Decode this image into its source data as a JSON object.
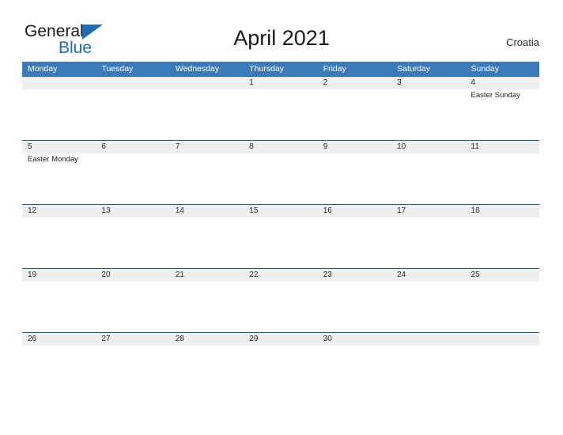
{
  "brand": {
    "name_part1": "General",
    "name_part2": "Blue",
    "triangle_icon": "triangle-right-icon",
    "color_dark": "#1a1a1a",
    "color_blue": "#1f6ab0"
  },
  "header": {
    "title": "April 2021",
    "region": "Croatia"
  },
  "theme": {
    "header_blue": "#3a7ab8",
    "rule_blue": "#1f5c9e",
    "date_band_gray": "#efefef",
    "page_background": "#ffffff",
    "text_color": "#2b2b2b"
  },
  "calendar": {
    "month": "April",
    "year": "2021",
    "weekday_headers": [
      "Monday",
      "Tuesday",
      "Wednesday",
      "Thursday",
      "Friday",
      "Saturday",
      "Sunday"
    ],
    "weeks": [
      {
        "days": [
          {
            "date": "",
            "events": []
          },
          {
            "date": "",
            "events": []
          },
          {
            "date": "",
            "events": []
          },
          {
            "date": "1",
            "events": []
          },
          {
            "date": "2",
            "events": []
          },
          {
            "date": "3",
            "events": []
          },
          {
            "date": "4",
            "events": [
              "Easter Sunday"
            ]
          }
        ]
      },
      {
        "days": [
          {
            "date": "5",
            "events": [
              "Easter Monday"
            ]
          },
          {
            "date": "6",
            "events": []
          },
          {
            "date": "7",
            "events": []
          },
          {
            "date": "8",
            "events": []
          },
          {
            "date": "9",
            "events": []
          },
          {
            "date": "10",
            "events": []
          },
          {
            "date": "11",
            "events": []
          }
        ]
      },
      {
        "days": [
          {
            "date": "12",
            "events": []
          },
          {
            "date": "13",
            "events": []
          },
          {
            "date": "14",
            "events": []
          },
          {
            "date": "15",
            "events": []
          },
          {
            "date": "16",
            "events": []
          },
          {
            "date": "17",
            "events": []
          },
          {
            "date": "18",
            "events": []
          }
        ]
      },
      {
        "days": [
          {
            "date": "19",
            "events": []
          },
          {
            "date": "20",
            "events": []
          },
          {
            "date": "21",
            "events": []
          },
          {
            "date": "22",
            "events": []
          },
          {
            "date": "23",
            "events": []
          },
          {
            "date": "24",
            "events": []
          },
          {
            "date": "25",
            "events": []
          }
        ]
      },
      {
        "days": [
          {
            "date": "26",
            "events": []
          },
          {
            "date": "27",
            "events": []
          },
          {
            "date": "28",
            "events": []
          },
          {
            "date": "29",
            "events": []
          },
          {
            "date": "30",
            "events": []
          },
          {
            "date": "",
            "events": []
          },
          {
            "date": "",
            "events": []
          }
        ]
      }
    ]
  }
}
